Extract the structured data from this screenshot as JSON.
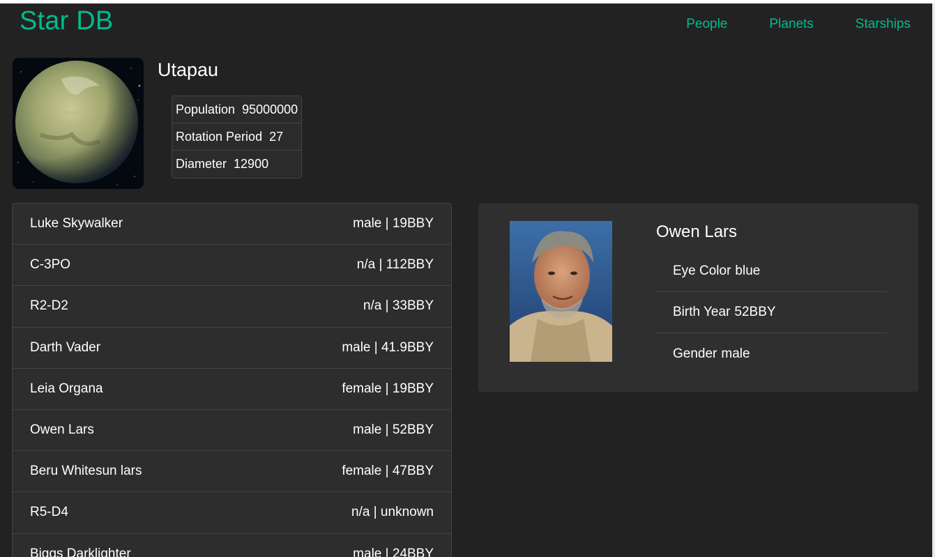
{
  "header": {
    "brand": "Star DB",
    "nav": [
      "People",
      "Planets",
      "Starships"
    ]
  },
  "planet": {
    "name": "Utapau",
    "image_alt": "planet image",
    "details": [
      {
        "term": "Population",
        "value": "95000000"
      },
      {
        "term": "Rotation Period",
        "value": "27"
      },
      {
        "term": "Diameter",
        "value": "12900"
      }
    ]
  },
  "people": [
    {
      "name": "Luke Skywalker",
      "info": "male | 19BBY"
    },
    {
      "name": "C-3PO",
      "info": "n/a | 112BBY"
    },
    {
      "name": "R2-D2",
      "info": "n/a | 33BBY"
    },
    {
      "name": "Darth Vader",
      "info": "male | 41.9BBY"
    },
    {
      "name": "Leia Organa",
      "info": "female | 19BBY"
    },
    {
      "name": "Owen Lars",
      "info": "male | 52BBY"
    },
    {
      "name": "Beru Whitesun lars",
      "info": "female | 47BBY"
    },
    {
      "name": "R5-D4",
      "info": "n/a | unknown"
    },
    {
      "name": "Biggs Darklighter",
      "info": "male | 24BBY"
    }
  ],
  "person": {
    "name": "Owen Lars",
    "details": [
      {
        "term": "Eye Color",
        "value": "blue"
      },
      {
        "term": "Birth Year",
        "value": "52BBY"
      },
      {
        "term": "Gender",
        "value": "male"
      }
    ]
  },
  "colors": {
    "accent": "#00bc8c",
    "background": "#222222",
    "card": "#2d2d2d"
  }
}
